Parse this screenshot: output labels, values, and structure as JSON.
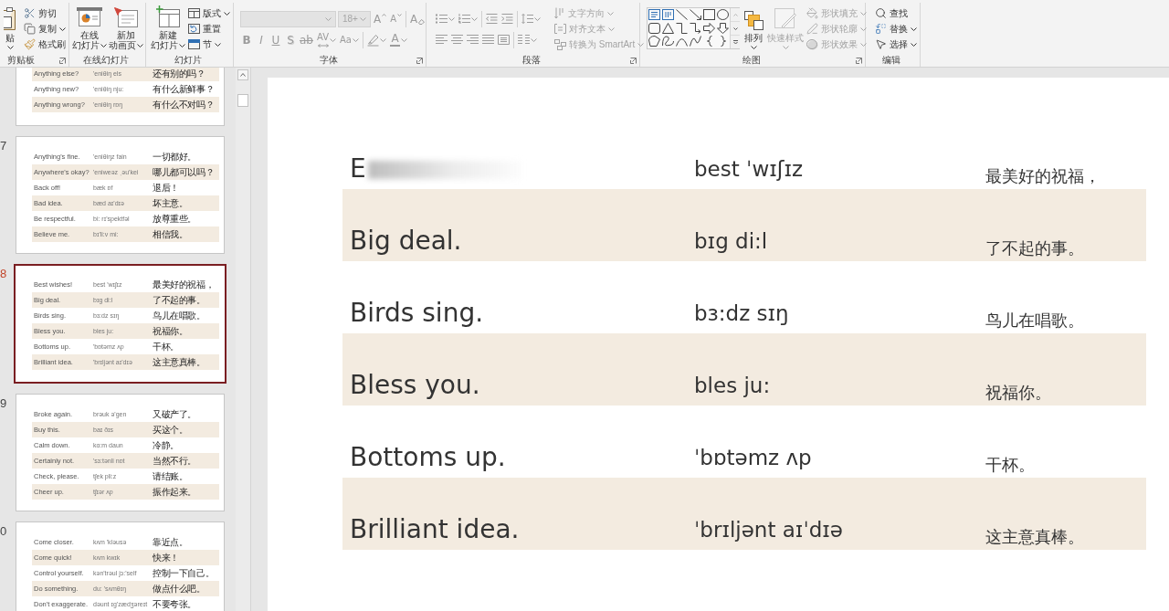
{
  "ribbon": {
    "groups": [
      {
        "label": "剪贴板",
        "launcher": true,
        "items": [
          {
            "kind": "large",
            "lines": [
              "贴"
            ],
            "dropdown": true,
            "disabled": false
          },
          {
            "kind": "small",
            "label": "剪切",
            "dropdown": false,
            "disabled": false
          },
          {
            "kind": "small",
            "label": "复制",
            "dropdown": true,
            "disabled": false
          },
          {
            "kind": "small",
            "label": "格式刷",
            "dropdown": false,
            "disabled": false
          }
        ]
      },
      {
        "label": "在线幻灯片",
        "launcher": false,
        "items": [
          {
            "kind": "large",
            "lines": [
              "在线",
              "幻灯片"
            ],
            "dropdown": true,
            "disabled": false
          },
          {
            "kind": "large",
            "lines": [
              "新加",
              "动画页"
            ],
            "dropdown": true,
            "disabled": false
          }
        ]
      },
      {
        "label": "幻灯片",
        "launcher": false,
        "items": [
          {
            "kind": "large",
            "lines": [
              "新建",
              "幻灯片"
            ],
            "dropdown": true,
            "disabled": false
          },
          {
            "kind": "small",
            "label": "版式",
            "dropdown": true,
            "disabled": false
          },
          {
            "kind": "small",
            "label": "重置",
            "dropdown": false,
            "disabled": false
          },
          {
            "kind": "small",
            "label": "节",
            "dropdown": true,
            "disabled": false
          }
        ]
      },
      {
        "label": "字体",
        "launcher": true,
        "strips": [
          {
            "sets": [
              {
                "tools": [
                  {
                    "kind": "combo",
                    "dropdown": true,
                    "disabled": true
                  },
                  {
                    "kind": "combo",
                    "value": "18+",
                    "dropdown": true,
                    "disabled": true
                  },
                  {
                    "kind": "text",
                    "text": "A",
                    "dropdown": false,
                    "disabled": true
                  },
                  {
                    "kind": "text",
                    "text": "A",
                    "dropdown": false,
                    "disabled": true
                  }
                ]
              },
              {
                "tools": [
                  {
                    "kind": "text",
                    "text": "A",
                    "dropdown": false,
                    "disabled": true
                  }
                ]
              }
            ]
          },
          {
            "sets": [
              {
                "tools": [
                  {
                    "kind": "text",
                    "text": "B",
                    "dropdown": false,
                    "disabled": true
                  },
                  {
                    "kind": "text",
                    "text": "I",
                    "dropdown": false,
                    "disabled": true
                  },
                  {
                    "kind": "text",
                    "text": "U",
                    "dropdown": false,
                    "disabled": true
                  },
                  {
                    "kind": "text",
                    "text": "S",
                    "dropdown": false,
                    "disabled": true
                  },
                  {
                    "kind": "text",
                    "text": "ab",
                    "dropdown": false,
                    "disabled": true
                  },
                  {
                    "kind": "text",
                    "text": "AV",
                    "dropdown": true,
                    "disabled": true
                  },
                  {
                    "kind": "text",
                    "text": "Aa",
                    "dropdown": true,
                    "disabled": true
                  }
                ]
              },
              {
                "tools": [
                  {
                    "kind": "icon",
                    "dropdown": true,
                    "disabled": true
                  },
                  {
                    "kind": "text",
                    "text": "A",
                    "dropdown": true,
                    "disabled": true
                  }
                ]
              }
            ]
          }
        ]
      },
      {
        "label": "段落",
        "launcher": true,
        "strips": [
          {
            "sets": [
              {
                "tools": [
                  {
                    "kind": "icon",
                    "dropdown": true,
                    "disabled": true
                  },
                  {
                    "kind": "icon",
                    "dropdown": true,
                    "disabled": true
                  }
                ]
              },
              {
                "tools": [
                  {
                    "kind": "icon",
                    "dropdown": false,
                    "disabled": true
                  },
                  {
                    "kind": "icon",
                    "dropdown": false,
                    "disabled": true
                  }
                ]
              },
              {
                "tools": [
                  {
                    "kind": "icon",
                    "dropdown": true,
                    "disabled": true
                  }
                ]
              }
            ]
          },
          {
            "sets": [
              {
                "tools": [
                  {
                    "kind": "icon",
                    "dropdown": false,
                    "disabled": true
                  },
                  {
                    "kind": "icon",
                    "dropdown": false,
                    "disabled": true
                  },
                  {
                    "kind": "icon",
                    "dropdown": false,
                    "disabled": true
                  },
                  {
                    "kind": "icon",
                    "dropdown": false,
                    "disabled": true
                  },
                  {
                    "kind": "icon",
                    "dropdown": false,
                    "disabled": true
                  }
                ]
              },
              {
                "tools": [
                  {
                    "kind": "icon",
                    "dropdown": true,
                    "disabled": true
                  }
                ]
              }
            ]
          }
        ],
        "items": [
          {
            "kind": "small",
            "label": "文字方向",
            "dropdown": true,
            "disabled": true
          },
          {
            "kind": "small",
            "label": "对齐文本",
            "dropdown": true,
            "disabled": true
          },
          {
            "kind": "small",
            "label": "转换为 SmartArt",
            "dropdown": true,
            "disabled": true
          }
        ]
      },
      {
        "label": "绘图",
        "launcher": true,
        "items": [
          {
            "kind": "gallery",
            "dropdown": false,
            "disabled": false
          },
          {
            "kind": "large",
            "lines": [
              "排列"
            ],
            "dropdown": true,
            "disabled": false
          },
          {
            "kind": "large",
            "lines": [
              "快速样式"
            ],
            "dropdown": true,
            "disabled": true
          },
          {
            "kind": "small",
            "label": "形状填充",
            "dropdown": true,
            "disabled": true
          },
          {
            "kind": "small",
            "label": "形状轮廓",
            "dropdown": true,
            "disabled": true
          },
          {
            "kind": "small",
            "label": "形状效果",
            "dropdown": true,
            "disabled": true
          }
        ]
      },
      {
        "label": "编辑",
        "launcher": false,
        "items": [
          {
            "kind": "small",
            "label": "查找",
            "dropdown": false,
            "disabled": false
          },
          {
            "kind": "small",
            "label": "替换",
            "dropdown": true,
            "disabled": false
          },
          {
            "kind": "small",
            "label": "选择",
            "dropdown": true,
            "disabled": false
          }
        ]
      }
    ]
  },
  "thumbnails": [
    {
      "selected": false,
      "rows": [
        {
          "phrase": "Anything else?",
          "phonetic": "'eniθiŋ els",
          "meaning": "还有别的吗？",
          "shaded": true
        },
        {
          "phrase": "Anything new?",
          "phonetic": "'eniθiŋ nju:",
          "meaning": "有什么新鲜事？",
          "shaded": false
        },
        {
          "phrase": "Anything wrong?",
          "phonetic": "'eniθiŋ rɒŋ",
          "meaning": "有什么不对吗？",
          "shaded": true
        }
      ]
    },
    {
      "number": "7",
      "selected": false,
      "rows": [
        {
          "phrase": "Anything's fine.",
          "phonetic": "'eniθiŋz fain",
          "meaning": "一切都好。",
          "shaded": false
        },
        {
          "phrase": "Anywhere's okay?",
          "phonetic": "'eniweəz ˌəu'kei",
          "meaning": "哪儿都可以吗？",
          "shaded": true
        },
        {
          "phrase": "Back off!",
          "phonetic": "bæk ɒf",
          "meaning": "退后！",
          "shaded": false
        },
        {
          "phrase": "Bad idea.",
          "phonetic": "bæd aɪ'dɪə",
          "meaning": "坏主意。",
          "shaded": true
        },
        {
          "phrase": "Be respectful.",
          "phonetic": "bi: rɪ'spektfəl",
          "meaning": "放尊重些。",
          "shaded": false
        },
        {
          "phrase": "Believe me.",
          "phonetic": "bɪ'li:v mi:",
          "meaning": "相信我。",
          "shaded": true
        }
      ]
    },
    {
      "number": "8",
      "selected": true,
      "rows": [
        {
          "phrase": "Best wishes!",
          "phonetic": "best 'wɪʃɪz",
          "meaning": "最美好的祝福，",
          "shaded": false
        },
        {
          "phrase": "Big deal.",
          "phonetic": "bɪg di:l",
          "meaning": "了不起的事。",
          "shaded": true
        },
        {
          "phrase": "Birds sing.",
          "phonetic": "bɜ:dz sɪŋ",
          "meaning": "鸟儿在唱歌。",
          "shaded": false
        },
        {
          "phrase": "Bless you.",
          "phonetic": "bles ju:",
          "meaning": "祝福你。",
          "shaded": true
        },
        {
          "phrase": "Bottoms up.",
          "phonetic": "'bɒtəmz ʌp",
          "meaning": "干杯。",
          "shaded": false
        },
        {
          "phrase": "Brilliant idea.",
          "phonetic": "'brɪljənt aɪ'dɪə",
          "meaning": "这主意真棒。",
          "shaded": true
        }
      ]
    },
    {
      "number": "9",
      "selected": false,
      "rows": [
        {
          "phrase": "Broke again.",
          "phonetic": "brəuk ə'gen",
          "meaning": "又破产了。",
          "shaded": false
        },
        {
          "phrase": "Buy this.",
          "phonetic": "baɪ ðɪs",
          "meaning": "买这个。",
          "shaded": true
        },
        {
          "phrase": "Calm down.",
          "phonetic": "kɑ:m daun",
          "meaning": "冷静。",
          "shaded": false
        },
        {
          "phrase": "Certainly not.",
          "phonetic": "'sɜ:tənli nɒt",
          "meaning": "当然不行。",
          "shaded": true
        },
        {
          "phrase": "Check, please.",
          "phonetic": "tʃek pli:z",
          "meaning": "请结账。",
          "shaded": false
        },
        {
          "phrase": "Cheer up.",
          "phonetic": "tʃɪər ʌp",
          "meaning": "振作起来。",
          "shaded": true
        }
      ]
    },
    {
      "number": "0",
      "selected": false,
      "rows": [
        {
          "phrase": "Come closer.",
          "phonetic": "kʌm 'kləusə",
          "meaning": "靠近点。",
          "shaded": false
        },
        {
          "phrase": "Come quick!",
          "phonetic": "kʌm kwɪk",
          "meaning": "快来！",
          "shaded": true
        },
        {
          "phrase": "Control yourself.",
          "phonetic": "kən'trəul jɔ:'self",
          "meaning": "控制一下自己。",
          "shaded": false
        },
        {
          "phrase": "Do something.",
          "phonetic": "du: 'sʌmθɪŋ",
          "meaning": "做点什么吧。",
          "shaded": true
        },
        {
          "phrase": "Don't exaggerate.",
          "phonetic": "dəunt ɪg'zædʒəreɪt",
          "meaning": "不要夸张。",
          "shaded": false
        }
      ]
    }
  ],
  "slide": {
    "rows": [
      {
        "phrase": "E",
        "blurred": true,
        "phonetic": "best ˈwɪʃɪz",
        "meaning": "最美好的祝福，",
        "shaded": false
      },
      {
        "phrase": "Big deal.",
        "blurred": false,
        "phonetic": "bɪg di:l",
        "meaning": "了不起的事。",
        "shaded": true
      },
      {
        "phrase": "Birds sing.",
        "blurred": false,
        "phonetic": "bɜ:dz sɪŋ",
        "meaning": "鸟儿在唱歌。",
        "shaded": false
      },
      {
        "phrase": "Bless you.",
        "blurred": false,
        "phonetic": "bles ju:",
        "meaning": "祝福你。",
        "shaded": true
      },
      {
        "phrase": "Bottoms up.",
        "blurred": false,
        "phonetic": "ˈbɒtəmz ʌp",
        "meaning": "干杯。",
        "shaded": false
      },
      {
        "phrase": "Brilliant idea.",
        "blurred": false,
        "phonetic": "ˈbrɪljənt aɪˈdɪə",
        "meaning": "这主意真棒。",
        "shaded": true
      }
    ]
  }
}
